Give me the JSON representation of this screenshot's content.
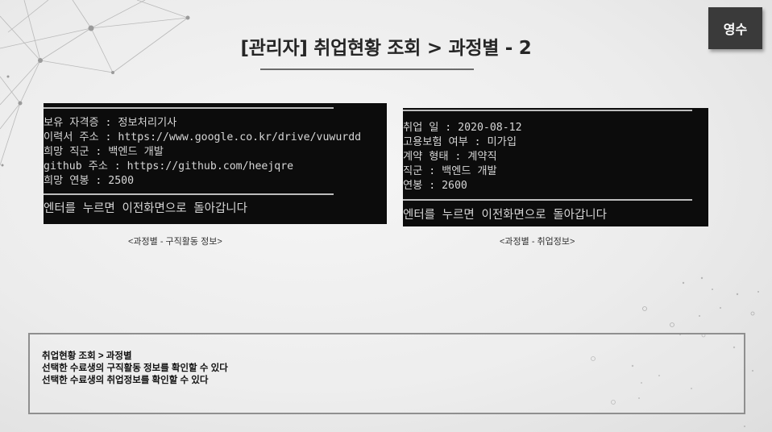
{
  "header": {
    "title": "[관리자] 취업현황 조회 > 과정별 - 2",
    "user_badge": "영수"
  },
  "left_panel": {
    "lines": [
      "보유 자격증 : 정보처리기사",
      "이력서 주소 : https://www.google.co.kr/drive/vuwurdd",
      "희망 직군 : 백엔드 개발",
      "github 주소 : https://github.com/heejqre",
      "희망 연봉 : 2500"
    ],
    "prompt": "엔터를 누르면 이전화면으로 돌아갑니다",
    "caption": "<과정별 - 구직활동 정보>"
  },
  "right_panel": {
    "lines": [
      "취업 일 : 2020-08-12",
      "고용보험 여부 : 미가입",
      "계약 형태 : 계약직",
      "직군 : 백엔드 개발",
      "연봉 : 2600"
    ],
    "prompt": "엔터를 누르면 이전화면으로 돌아갑니다",
    "caption": "<과정별 - 취업정보>"
  },
  "description": {
    "lines": [
      "취업현황 조회 > 과정별",
      "선택한 수료생의 구직활동 정보를 확인할 수 있다",
      "선택한 수료생의 취업정보를 확인할 수 있다"
    ]
  },
  "colors": {
    "console_bg": "#0c0c0c",
    "console_text": "#d6d6d6",
    "badge_bg": "#3a3a3a"
  }
}
